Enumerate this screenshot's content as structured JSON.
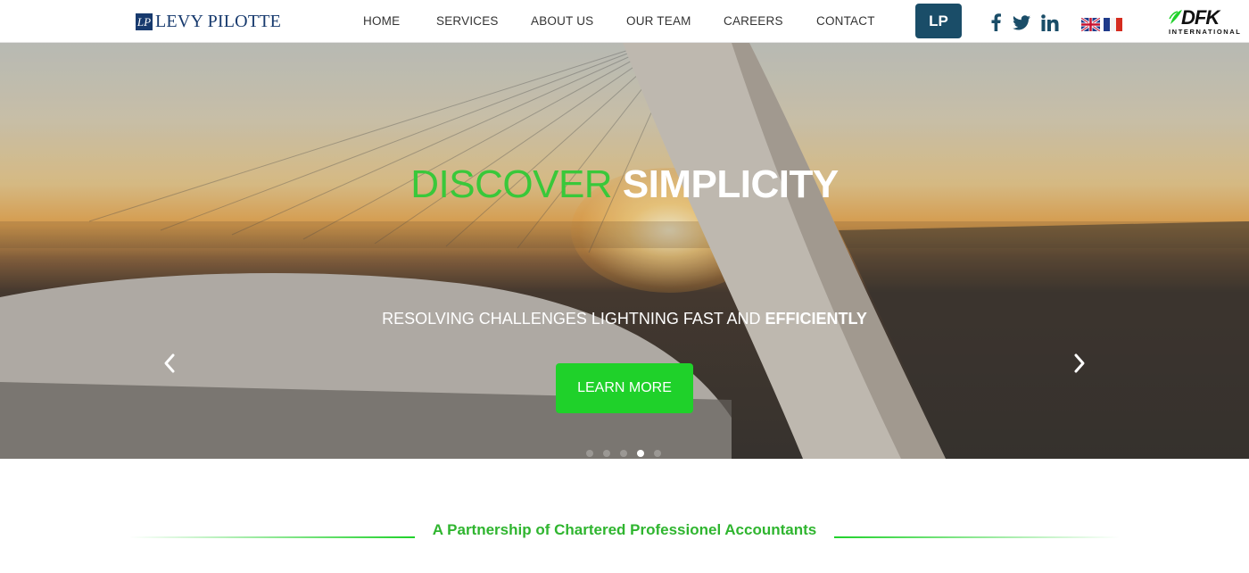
{
  "header": {
    "logo_mark": "LP",
    "logo_text": "LEVY PILOTTE",
    "nav": [
      {
        "label": "HOME"
      },
      {
        "label": "SERVICES"
      },
      {
        "label": "ABOUT US"
      },
      {
        "label": "OUR TEAM"
      },
      {
        "label": "CAREERS"
      },
      {
        "label": "CONTACT"
      }
    ],
    "lp_button": "LP",
    "social": [
      "facebook-icon",
      "twitter-icon",
      "linkedin-icon"
    ],
    "languages": [
      "English",
      "Français"
    ],
    "partner_logo": "DFK",
    "partner_logo_sub": "INTERNATIONAL"
  },
  "hero": {
    "title_part1": "DISCOVER ",
    "title_part2": "SIMPLICITY",
    "subtitle_part1": "RESOLVING CHALLENGES LIGHTNING FAST AND ",
    "subtitle_part2": "EFFICIENTLY",
    "cta_label": "LEARN MORE",
    "slide_count": 5,
    "active_slide": 4
  },
  "tagline": "A Partnership of Chartered Professionel Accountants",
  "colors": {
    "brand_navy": "#173a6e",
    "lp_button_bg": "#1a4d68",
    "accent_green": "#1fd12a",
    "title_green": "#39c83a"
  }
}
